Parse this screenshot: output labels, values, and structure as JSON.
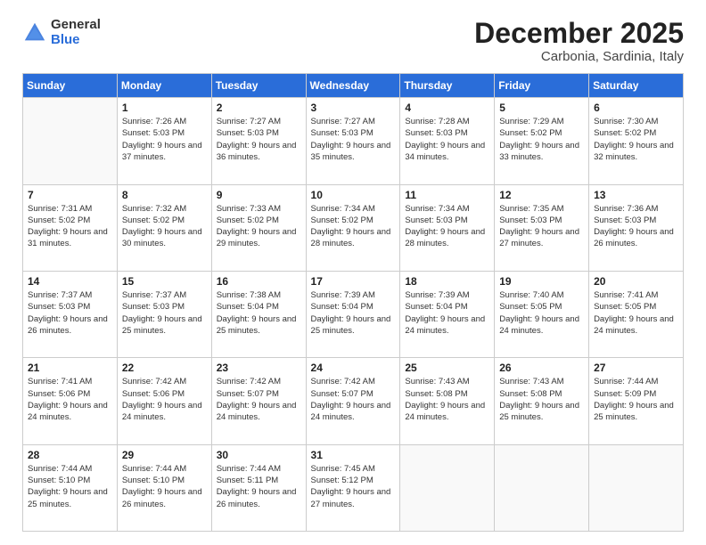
{
  "logo": {
    "general": "General",
    "blue": "Blue"
  },
  "header": {
    "month": "December 2025",
    "location": "Carbonia, Sardinia, Italy"
  },
  "weekdays": [
    "Sunday",
    "Monday",
    "Tuesday",
    "Wednesday",
    "Thursday",
    "Friday",
    "Saturday"
  ],
  "weeks": [
    [
      {
        "num": "",
        "sunrise": "",
        "sunset": "",
        "daylight": ""
      },
      {
        "num": "1",
        "sunrise": "Sunrise: 7:26 AM",
        "sunset": "Sunset: 5:03 PM",
        "daylight": "Daylight: 9 hours and 37 minutes."
      },
      {
        "num": "2",
        "sunrise": "Sunrise: 7:27 AM",
        "sunset": "Sunset: 5:03 PM",
        "daylight": "Daylight: 9 hours and 36 minutes."
      },
      {
        "num": "3",
        "sunrise": "Sunrise: 7:27 AM",
        "sunset": "Sunset: 5:03 PM",
        "daylight": "Daylight: 9 hours and 35 minutes."
      },
      {
        "num": "4",
        "sunrise": "Sunrise: 7:28 AM",
        "sunset": "Sunset: 5:03 PM",
        "daylight": "Daylight: 9 hours and 34 minutes."
      },
      {
        "num": "5",
        "sunrise": "Sunrise: 7:29 AM",
        "sunset": "Sunset: 5:02 PM",
        "daylight": "Daylight: 9 hours and 33 minutes."
      },
      {
        "num": "6",
        "sunrise": "Sunrise: 7:30 AM",
        "sunset": "Sunset: 5:02 PM",
        "daylight": "Daylight: 9 hours and 32 minutes."
      }
    ],
    [
      {
        "num": "7",
        "sunrise": "Sunrise: 7:31 AM",
        "sunset": "Sunset: 5:02 PM",
        "daylight": "Daylight: 9 hours and 31 minutes."
      },
      {
        "num": "8",
        "sunrise": "Sunrise: 7:32 AM",
        "sunset": "Sunset: 5:02 PM",
        "daylight": "Daylight: 9 hours and 30 minutes."
      },
      {
        "num": "9",
        "sunrise": "Sunrise: 7:33 AM",
        "sunset": "Sunset: 5:02 PM",
        "daylight": "Daylight: 9 hours and 29 minutes."
      },
      {
        "num": "10",
        "sunrise": "Sunrise: 7:34 AM",
        "sunset": "Sunset: 5:02 PM",
        "daylight": "Daylight: 9 hours and 28 minutes."
      },
      {
        "num": "11",
        "sunrise": "Sunrise: 7:34 AM",
        "sunset": "Sunset: 5:03 PM",
        "daylight": "Daylight: 9 hours and 28 minutes."
      },
      {
        "num": "12",
        "sunrise": "Sunrise: 7:35 AM",
        "sunset": "Sunset: 5:03 PM",
        "daylight": "Daylight: 9 hours and 27 minutes."
      },
      {
        "num": "13",
        "sunrise": "Sunrise: 7:36 AM",
        "sunset": "Sunset: 5:03 PM",
        "daylight": "Daylight: 9 hours and 26 minutes."
      }
    ],
    [
      {
        "num": "14",
        "sunrise": "Sunrise: 7:37 AM",
        "sunset": "Sunset: 5:03 PM",
        "daylight": "Daylight: 9 hours and 26 minutes."
      },
      {
        "num": "15",
        "sunrise": "Sunrise: 7:37 AM",
        "sunset": "Sunset: 5:03 PM",
        "daylight": "Daylight: 9 hours and 25 minutes."
      },
      {
        "num": "16",
        "sunrise": "Sunrise: 7:38 AM",
        "sunset": "Sunset: 5:04 PM",
        "daylight": "Daylight: 9 hours and 25 minutes."
      },
      {
        "num": "17",
        "sunrise": "Sunrise: 7:39 AM",
        "sunset": "Sunset: 5:04 PM",
        "daylight": "Daylight: 9 hours and 25 minutes."
      },
      {
        "num": "18",
        "sunrise": "Sunrise: 7:39 AM",
        "sunset": "Sunset: 5:04 PM",
        "daylight": "Daylight: 9 hours and 24 minutes."
      },
      {
        "num": "19",
        "sunrise": "Sunrise: 7:40 AM",
        "sunset": "Sunset: 5:05 PM",
        "daylight": "Daylight: 9 hours and 24 minutes."
      },
      {
        "num": "20",
        "sunrise": "Sunrise: 7:41 AM",
        "sunset": "Sunset: 5:05 PM",
        "daylight": "Daylight: 9 hours and 24 minutes."
      }
    ],
    [
      {
        "num": "21",
        "sunrise": "Sunrise: 7:41 AM",
        "sunset": "Sunset: 5:06 PM",
        "daylight": "Daylight: 9 hours and 24 minutes."
      },
      {
        "num": "22",
        "sunrise": "Sunrise: 7:42 AM",
        "sunset": "Sunset: 5:06 PM",
        "daylight": "Daylight: 9 hours and 24 minutes."
      },
      {
        "num": "23",
        "sunrise": "Sunrise: 7:42 AM",
        "sunset": "Sunset: 5:07 PM",
        "daylight": "Daylight: 9 hours and 24 minutes."
      },
      {
        "num": "24",
        "sunrise": "Sunrise: 7:42 AM",
        "sunset": "Sunset: 5:07 PM",
        "daylight": "Daylight: 9 hours and 24 minutes."
      },
      {
        "num": "25",
        "sunrise": "Sunrise: 7:43 AM",
        "sunset": "Sunset: 5:08 PM",
        "daylight": "Daylight: 9 hours and 24 minutes."
      },
      {
        "num": "26",
        "sunrise": "Sunrise: 7:43 AM",
        "sunset": "Sunset: 5:08 PM",
        "daylight": "Daylight: 9 hours and 25 minutes."
      },
      {
        "num": "27",
        "sunrise": "Sunrise: 7:44 AM",
        "sunset": "Sunset: 5:09 PM",
        "daylight": "Daylight: 9 hours and 25 minutes."
      }
    ],
    [
      {
        "num": "28",
        "sunrise": "Sunrise: 7:44 AM",
        "sunset": "Sunset: 5:10 PM",
        "daylight": "Daylight: 9 hours and 25 minutes."
      },
      {
        "num": "29",
        "sunrise": "Sunrise: 7:44 AM",
        "sunset": "Sunset: 5:10 PM",
        "daylight": "Daylight: 9 hours and 26 minutes."
      },
      {
        "num": "30",
        "sunrise": "Sunrise: 7:44 AM",
        "sunset": "Sunset: 5:11 PM",
        "daylight": "Daylight: 9 hours and 26 minutes."
      },
      {
        "num": "31",
        "sunrise": "Sunrise: 7:45 AM",
        "sunset": "Sunset: 5:12 PM",
        "daylight": "Daylight: 9 hours and 27 minutes."
      },
      {
        "num": "",
        "sunrise": "",
        "sunset": "",
        "daylight": ""
      },
      {
        "num": "",
        "sunrise": "",
        "sunset": "",
        "daylight": ""
      },
      {
        "num": "",
        "sunrise": "",
        "sunset": "",
        "daylight": ""
      }
    ]
  ]
}
